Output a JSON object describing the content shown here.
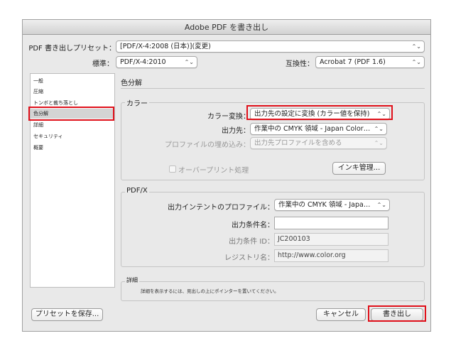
{
  "window": {
    "title": "Adobe PDF を書き出し"
  },
  "top": {
    "preset_label": "PDF 書き出しプリセット：",
    "preset_value": "[PDF/X-4:2008 (日本)](変更)",
    "standard_label": "標準：",
    "standard_value": "PDF/X-4:2010",
    "compat_label": "互換性：",
    "compat_value": "Acrobat 7 (PDF 1.6)"
  },
  "sidebar": {
    "items": [
      {
        "label": "一般",
        "selected": false
      },
      {
        "label": "圧縮",
        "selected": false
      },
      {
        "label": "トンボと裁ち落とし",
        "selected": false
      },
      {
        "label": "色分解",
        "selected": true
      },
      {
        "label": "詳細",
        "selected": false
      },
      {
        "label": "セキュリティ",
        "selected": false
      },
      {
        "label": "概要",
        "selected": false
      }
    ]
  },
  "panel": {
    "title": "色分解",
    "color_group": {
      "title": "カラー",
      "conversion_label": "カラー変換：",
      "conversion_value": "出力先の設定に変換 (カラー値を保持)",
      "destination_label": "出力先：",
      "destination_value": "作業中の CMYK 領域 - Japan Color…",
      "profile_label": "プロファイルの埋め込み：",
      "profile_value": "出力先プロファイルを含める",
      "overprint_label": "オーバープリント処理",
      "ink_manager_label": "インキ管理..."
    },
    "pdfx_group": {
      "title": "PDF/X",
      "output_intent_label": "出力インテントのプロファイル：",
      "output_intent_value": "作業中の CMYK 領域 - Japa…",
      "condition_name_label": "出力条件名：",
      "condition_name_value": "",
      "condition_id_label": "出力条件 ID：",
      "condition_id_value": "JC200103",
      "registry_label": "レジストリ名：",
      "registry_value": "http://www.color.org"
    },
    "description_group": {
      "title": "詳細",
      "text": "詳細を表示するには、見出しの上にポインターを置いてください。"
    }
  },
  "footer": {
    "save_preset_label": "プリセットを保存...",
    "cancel_label": "キャンセル",
    "export_label": "書き出し"
  },
  "colors": {
    "highlight_box": "#e0101a",
    "selected_item": "#d4d4d4"
  }
}
